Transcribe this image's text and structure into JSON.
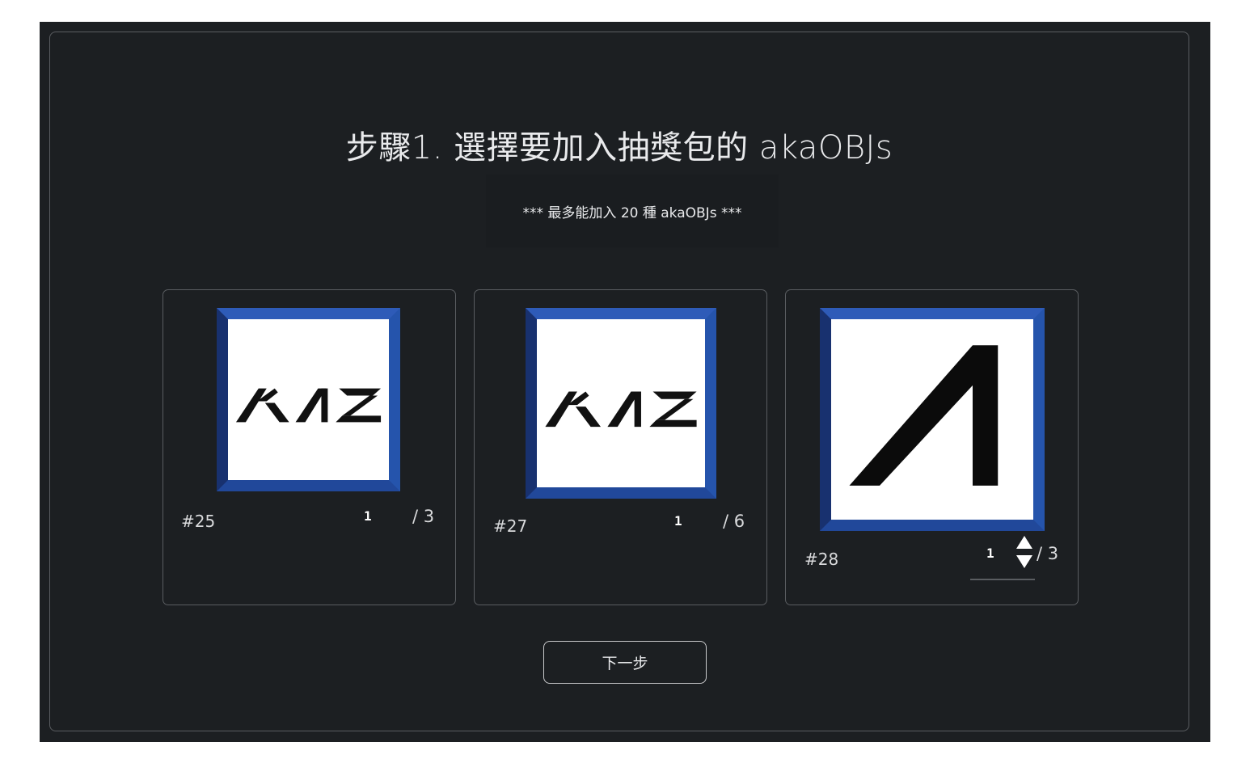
{
  "page": {
    "title": "步驟1. 選擇要加入抽獎包的 akaOBJs",
    "notice": "*** 最多能加入 20 種 akaOBJs ***"
  },
  "cards": [
    {
      "id": "#25",
      "quantity": "1",
      "max": "/ 3",
      "logo": "akas-wordmark"
    },
    {
      "id": "#27",
      "quantity": "1",
      "max": "/ 6",
      "logo": "akas-wordmark"
    },
    {
      "id": "#28",
      "quantity": "1",
      "max": "/ 3",
      "logo": "akas-a-mark"
    }
  ],
  "actions": {
    "next_label": "下一步"
  },
  "colors": {
    "background": "#1c1f22",
    "frame_blue": "#2554ac",
    "border": "#5a5d61"
  }
}
